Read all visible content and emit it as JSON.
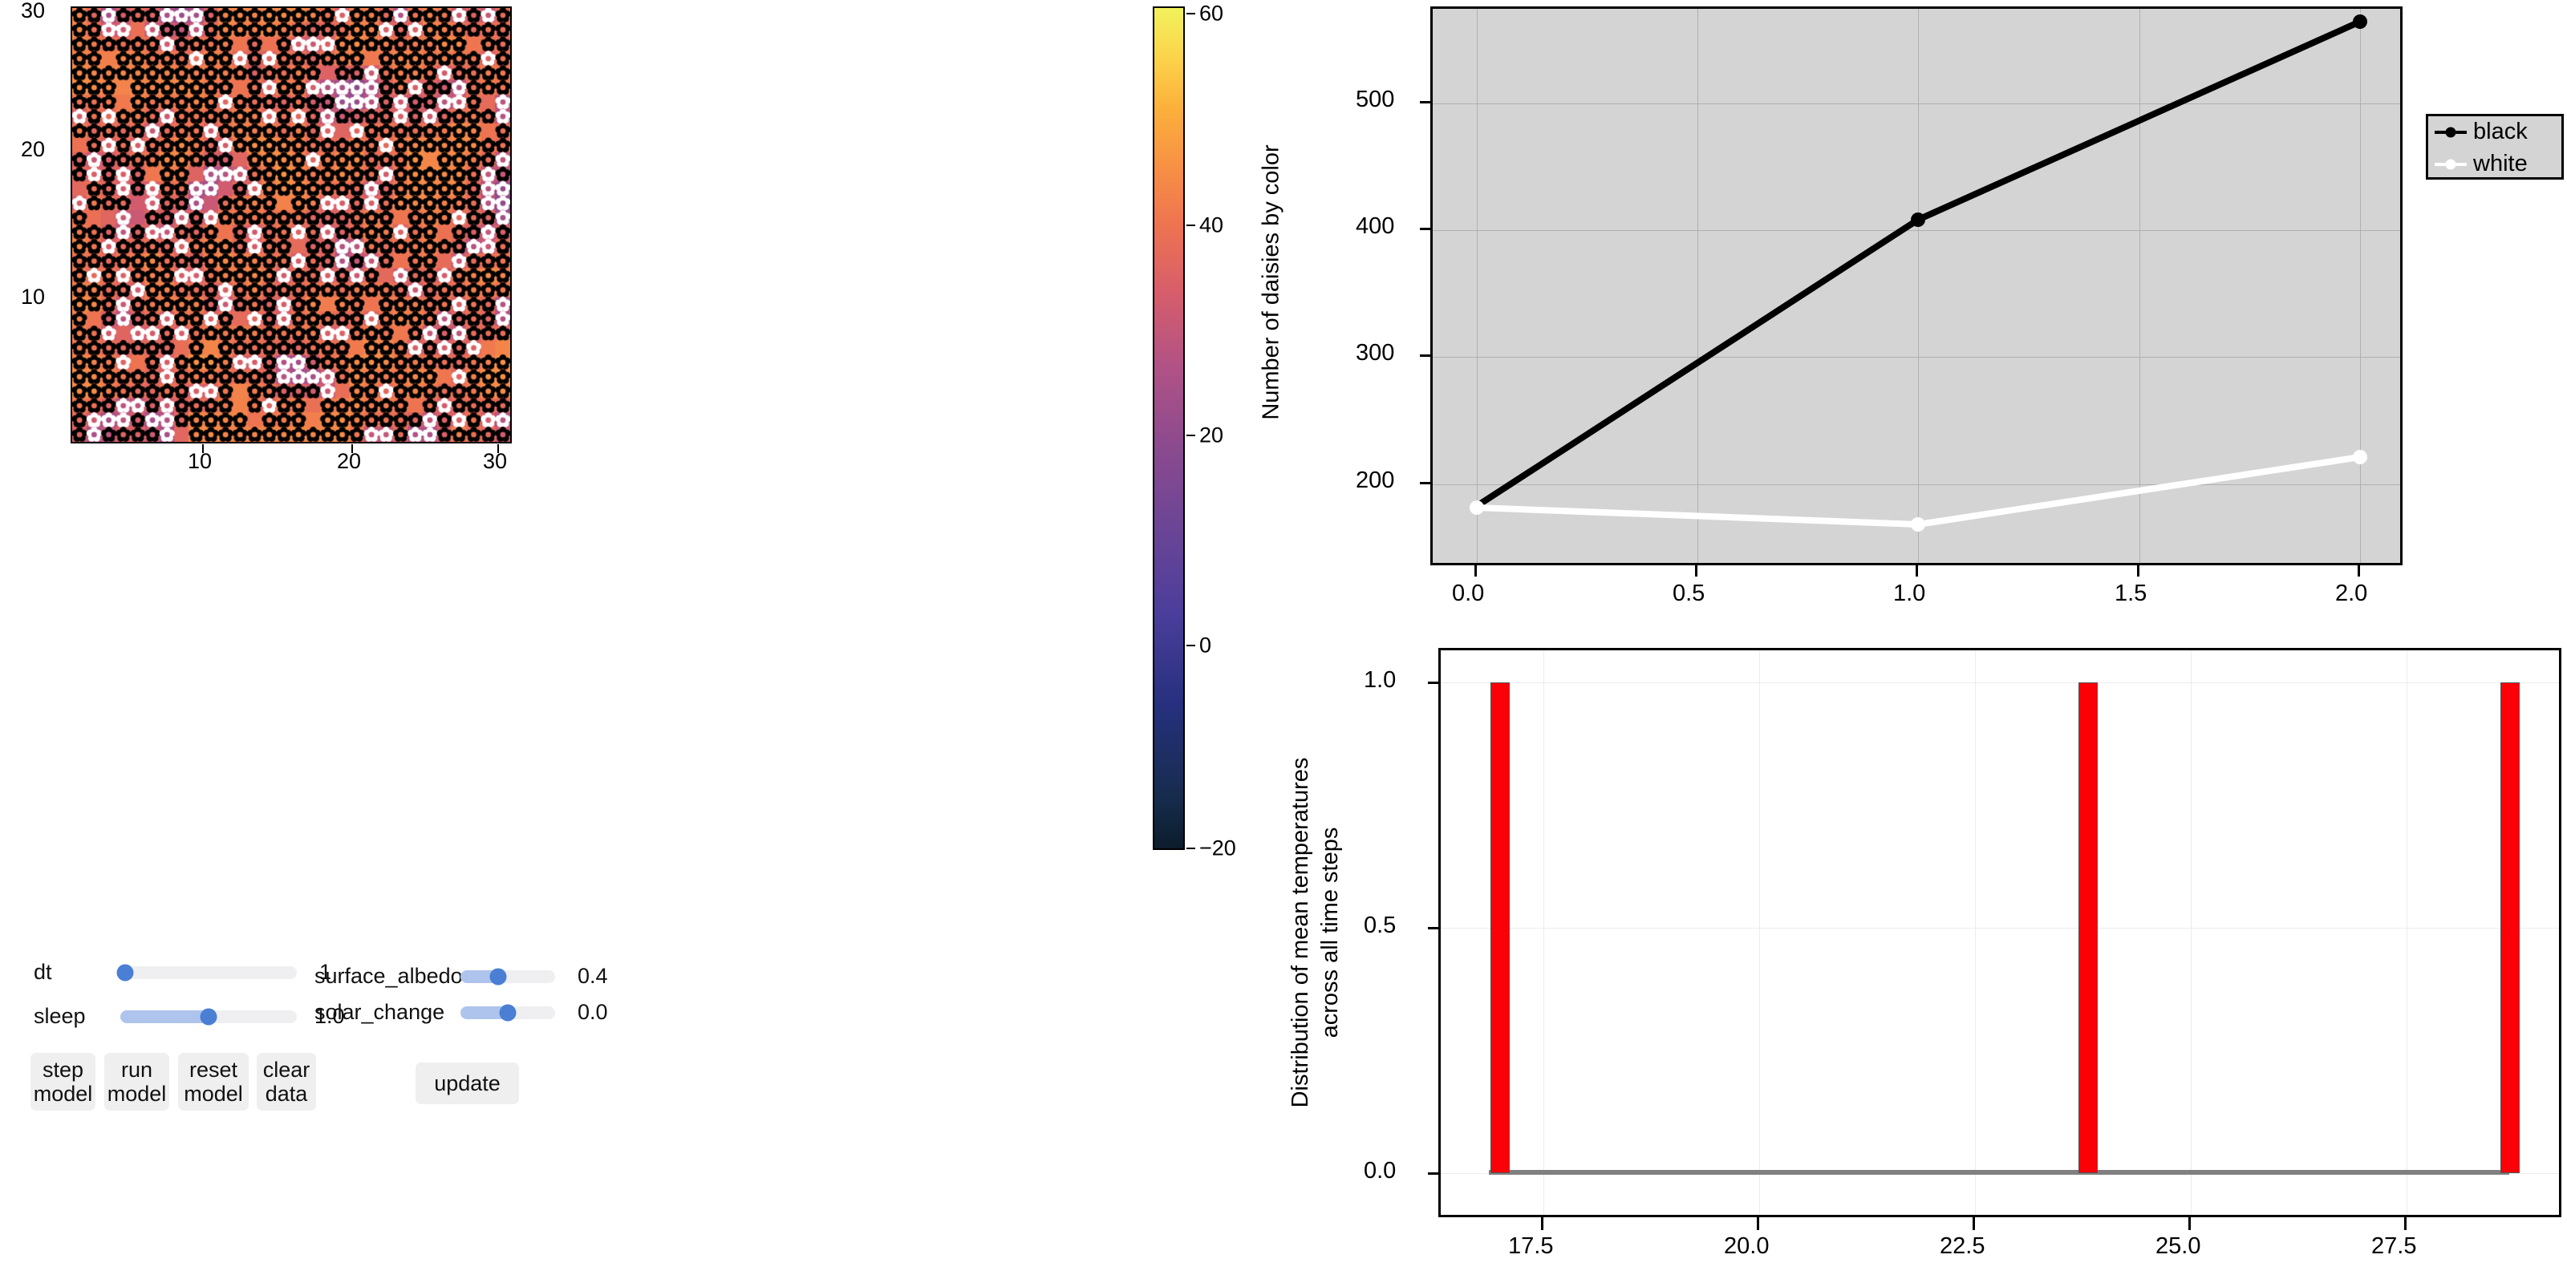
{
  "grid_plot": {
    "name": "daisyworld-temperature-grid",
    "x_ticks": [
      "10",
      "20",
      "30"
    ],
    "y_ticks": [
      "10",
      "20",
      "30"
    ],
    "grid_size": 30,
    "background_accent": "#e8713f"
  },
  "colorbar": {
    "name": "temperature-colorbar",
    "ticks": [
      "60",
      "40",
      "20",
      "0",
      "−20"
    ],
    "tick_values": [
      60,
      40,
      20,
      0,
      -20
    ],
    "vmin": -20,
    "vmax": 60,
    "colormap": "magma-like"
  },
  "controls": {
    "sliders": [
      {
        "label": "dt",
        "value": "1",
        "fill_fraction": 0.02
      },
      {
        "label": "sleep",
        "value": "1.0",
        "fill_fraction": 0.5
      },
      {
        "label": "surface_albedo",
        "value": "0.4",
        "fill_fraction": 0.4
      },
      {
        "label": "solar_change",
        "value": "0.0",
        "fill_fraction": 0.5
      }
    ],
    "buttons": [
      {
        "label": "step\nmodel"
      },
      {
        "label": "run\nmodel"
      },
      {
        "label": "reset\nmodel"
      },
      {
        "label": "clear\ndata"
      },
      {
        "label": "update"
      }
    ],
    "accent_color": "#4a7fd4",
    "track_color": "#efeff1",
    "fill_color": "#aec4ec",
    "button_color": "#efefef"
  },
  "chart_data": [
    {
      "type": "line",
      "name": "daisy-population-line-chart",
      "title": "",
      "xlabel": "",
      "ylabel": "Number of daisies by color",
      "x": [
        0.0,
        1.0,
        2.0
      ],
      "xticks": [
        "0.0",
        "0.5",
        "1.0",
        "1.5",
        "2.0"
      ],
      "xtick_values": [
        0.0,
        0.5,
        1.0,
        1.5,
        2.0
      ],
      "yticks": [
        "200",
        "300",
        "400",
        "500"
      ],
      "ytick_values": [
        200,
        300,
        400,
        500
      ],
      "xlim": [
        -0.1,
        2.1
      ],
      "ylim": [
        152,
        592
      ],
      "grid": true,
      "legend_position": "right",
      "plot_bg": "#d4d4d4",
      "series": [
        {
          "name": "black",
          "color": "#000000",
          "values": [
            183,
            409,
            565
          ]
        },
        {
          "name": "white",
          "color": "#ffffff",
          "values": [
            182,
            169,
            222
          ]
        }
      ]
    },
    {
      "type": "bar",
      "name": "mean-temperature-histogram",
      "title": "",
      "xlabel": "",
      "ylabel": "Distribution of mean temperatures\nacross all time steps",
      "ylabel_line1": "Distribution of mean temperatures",
      "ylabel_line2": "across all time steps",
      "categories": [
        "16.9",
        "23.7",
        "28.6"
      ],
      "values": [
        1.0,
        1.0,
        1.0
      ],
      "xticks": [
        "17.5",
        "20.0",
        "22.5",
        "25.0",
        "27.5"
      ],
      "xtick_values": [
        17.5,
        20.0,
        22.5,
        25.0,
        27.5
      ],
      "yticks": [
        "0.0",
        "0.5",
        "1.0"
      ],
      "ytick_values": [
        0.0,
        0.5,
        1.0
      ],
      "xlim": [
        16.3,
        29.3
      ],
      "ylim": [
        0.0,
        1.07
      ],
      "grid": true,
      "bar_color": "#fb0007",
      "plot_bg": "#ffffff"
    }
  ]
}
